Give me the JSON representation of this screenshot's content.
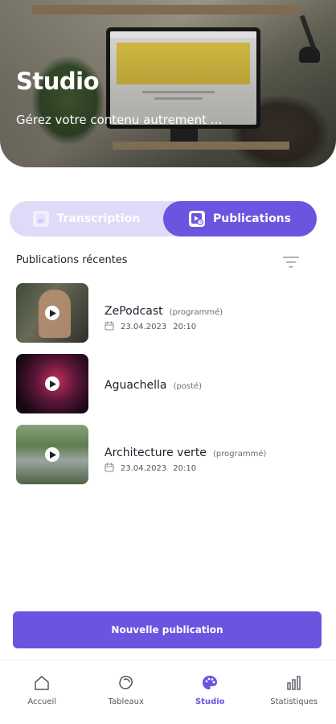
{
  "hero": {
    "title": "Studio",
    "subtitle": "Gérez votre contenu autrement ..."
  },
  "tabs": [
    {
      "label": "Transcription",
      "icon": "transcript-icon",
      "active": false
    },
    {
      "label": "Publications",
      "icon": "video-clock-icon",
      "active": true
    }
  ],
  "section": {
    "title": "Publications récentes",
    "filter_icon": "filter-icon"
  },
  "publications": [
    {
      "title": "ZePodcast",
      "status": "(programmé)",
      "date": "23.04.2023",
      "time": "20:10"
    },
    {
      "title": "Aguachella",
      "status": "(posté)"
    },
    {
      "title": "Architecture verte",
      "status": "(programmé)",
      "date": "23.04.2023",
      "time": "20:10"
    }
  ],
  "primary_button": {
    "label": "Nouvelle publication"
  },
  "bottom_nav": [
    {
      "label": "Accueil",
      "icon": "home-icon",
      "active": false
    },
    {
      "label": "Tableaux",
      "icon": "boards-icon",
      "active": false
    },
    {
      "label": "Studio",
      "icon": "palette-icon",
      "active": true
    },
    {
      "label": "Statistiques",
      "icon": "stats-icon",
      "active": false
    }
  ],
  "colors": {
    "accent": "#6a55e0",
    "accent_light": "#dedbf8",
    "text": "#1f1f2e"
  }
}
